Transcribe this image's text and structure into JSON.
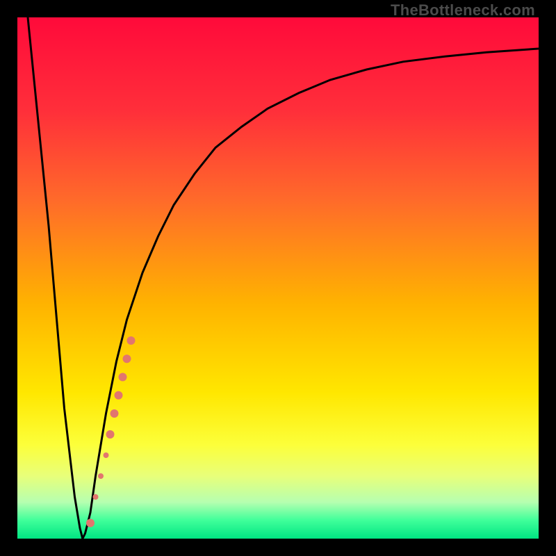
{
  "watermark": "TheBottleneck.com",
  "colors": {
    "frame": "#000000",
    "curve": "#000000",
    "marker": "#e2766e",
    "gradient_stops": [
      {
        "offset": 0.0,
        "color": "#ff0a3a"
      },
      {
        "offset": 0.18,
        "color": "#ff2f3a"
      },
      {
        "offset": 0.35,
        "color": "#ff6a2a"
      },
      {
        "offset": 0.55,
        "color": "#ffb300"
      },
      {
        "offset": 0.72,
        "color": "#ffe700"
      },
      {
        "offset": 0.82,
        "color": "#fcff3a"
      },
      {
        "offset": 0.88,
        "color": "#e8ff7a"
      },
      {
        "offset": 0.93,
        "color": "#b6ffb0"
      },
      {
        "offset": 0.965,
        "color": "#3fff9a"
      },
      {
        "offset": 1.0,
        "color": "#00e582"
      }
    ]
  },
  "chart_data": {
    "type": "line",
    "title": "",
    "xlabel": "",
    "ylabel": "",
    "xlim": [
      0,
      100
    ],
    "ylim": [
      0,
      100
    ],
    "series": [
      {
        "name": "bottleneck-curve",
        "x": [
          2,
          6,
          9,
          11,
          12,
          12.5,
          13,
          14,
          15,
          17,
          19,
          21,
          24,
          27,
          30,
          34,
          38,
          43,
          48,
          54,
          60,
          67,
          74,
          82,
          90,
          100
        ],
        "y": [
          100,
          60,
          25,
          8,
          2,
          0,
          1,
          5,
          12,
          24,
          34,
          42,
          51,
          58,
          64,
          70,
          75,
          79,
          82.5,
          85.5,
          88,
          90,
          91.5,
          92.5,
          93.3,
          94
        ]
      }
    ],
    "markers": [
      {
        "x": 14.0,
        "y": 3.0,
        "r": 6
      },
      {
        "x": 15.0,
        "y": 8.0,
        "r": 4
      },
      {
        "x": 16.0,
        "y": 12.0,
        "r": 4
      },
      {
        "x": 17.0,
        "y": 16.0,
        "r": 4
      },
      {
        "x": 17.8,
        "y": 20.0,
        "r": 6
      },
      {
        "x": 18.6,
        "y": 24.0,
        "r": 6
      },
      {
        "x": 19.4,
        "y": 27.5,
        "r": 6
      },
      {
        "x": 20.2,
        "y": 31.0,
        "r": 6
      },
      {
        "x": 21.0,
        "y": 34.5,
        "r": 6
      },
      {
        "x": 21.8,
        "y": 38.0,
        "r": 6
      }
    ]
  }
}
